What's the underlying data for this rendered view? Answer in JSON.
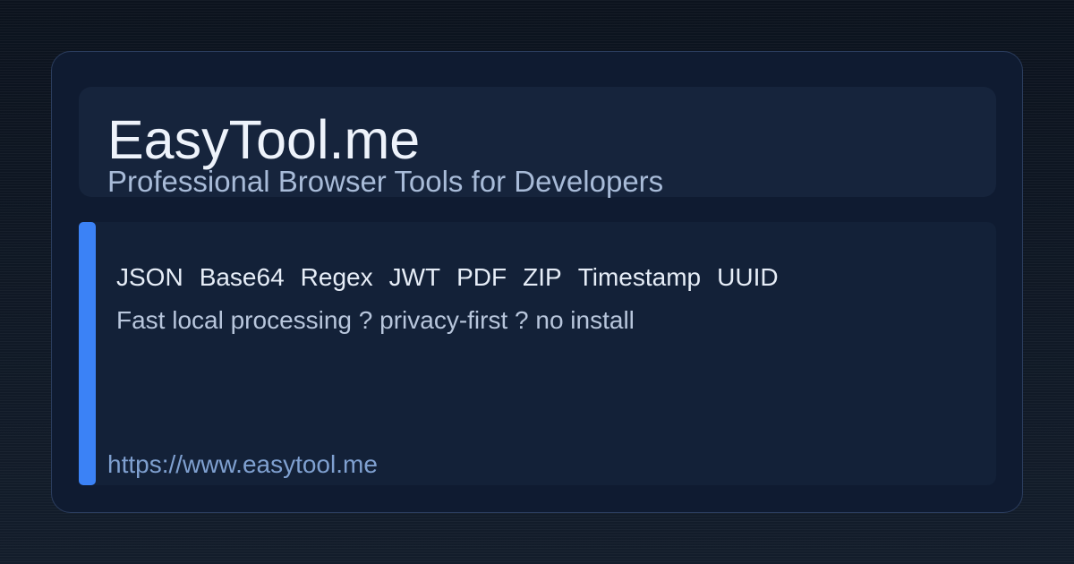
{
  "brand": {
    "title": "EasyTool.me",
    "subtitle": "Professional Browser Tools for Developers"
  },
  "tools": [
    "JSON",
    "Base64",
    "Regex",
    "JWT",
    "PDF",
    "ZIP",
    "Timestamp",
    "UUID"
  ],
  "tagline": "Fast local processing ? privacy-first ? no install",
  "url": "https://www.easytool.me",
  "colors": {
    "accent": "#3b82f6",
    "card_background": "#0f1b31",
    "title_text": "#eef3fb",
    "subtitle_text": "#a8bbd8",
    "url_text": "#7fa0d0"
  }
}
